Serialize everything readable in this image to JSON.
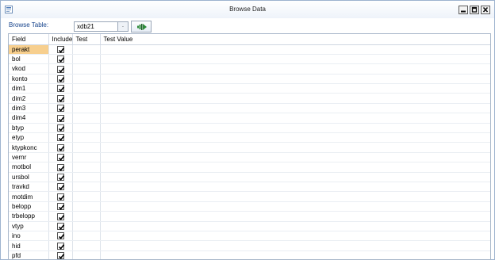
{
  "window": {
    "title": "Browse Data"
  },
  "toolbar": {
    "browse_label": "Browse Table:",
    "table_value": "xdb21",
    "dropdown_glyph": "."
  },
  "grid": {
    "columns": [
      "Field",
      "Include",
      "Test",
      "Test Value"
    ],
    "rows": [
      {
        "field": "perakt",
        "include": true
      },
      {
        "field": "bol",
        "include": true
      },
      {
        "field": "vkod",
        "include": true
      },
      {
        "field": "konto",
        "include": true
      },
      {
        "field": "dim1",
        "include": true
      },
      {
        "field": "dim2",
        "include": true
      },
      {
        "field": "dim3",
        "include": true
      },
      {
        "field": "dim4",
        "include": true
      },
      {
        "field": "btyp",
        "include": true
      },
      {
        "field": "etyp",
        "include": true
      },
      {
        "field": "ktypkonc",
        "include": true
      },
      {
        "field": "vernr",
        "include": true
      },
      {
        "field": "motbol",
        "include": true
      },
      {
        "field": "ursbol",
        "include": true
      },
      {
        "field": "travkd",
        "include": true
      },
      {
        "field": "motdim",
        "include": true
      },
      {
        "field": "belopp",
        "include": true
      },
      {
        "field": "trbelopp",
        "include": true
      },
      {
        "field": "vtyp",
        "include": true
      },
      {
        "field": "ino",
        "include": true
      },
      {
        "field": "hid",
        "include": true
      },
      {
        "field": "pfd",
        "include": true
      }
    ],
    "selected_row": 0
  },
  "icons": [
    "app-icon",
    "minimize-icon",
    "maximize-icon",
    "close-icon",
    "run-icon",
    "checkmark-icon"
  ],
  "colors": {
    "selected_cell": "#f7cf8e",
    "label_blue": "#15428b",
    "run_icon_green": "#2e8b3a"
  }
}
